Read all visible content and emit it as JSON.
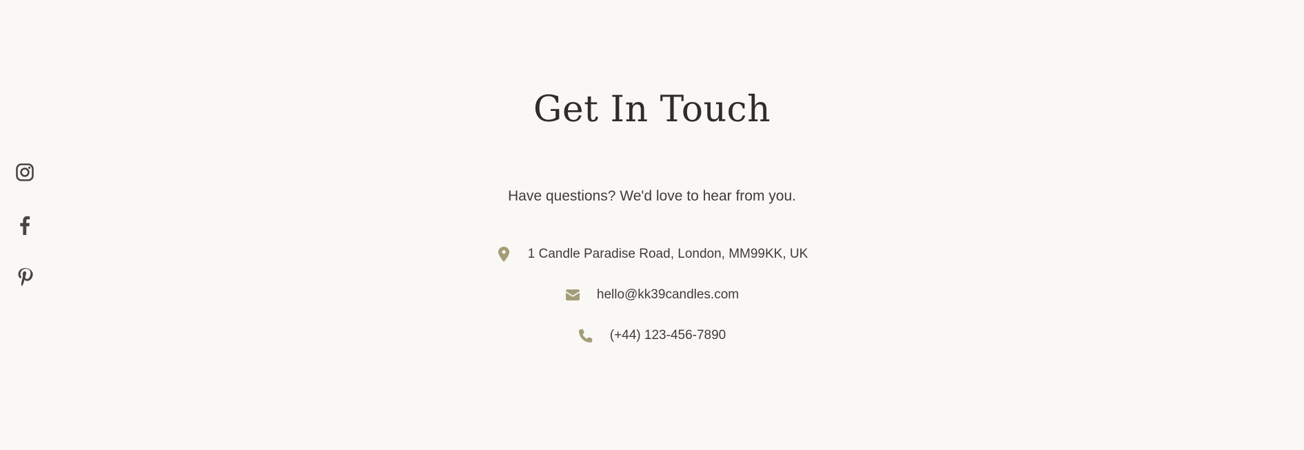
{
  "colors": {
    "background": "#faf8f5",
    "text": "#3f3b38",
    "heading": "#2f2c2a",
    "accent": "#a39d78",
    "social_icon": "#4a4542"
  },
  "social": [
    {
      "icon": "instagram-icon"
    },
    {
      "icon": "facebook-icon"
    },
    {
      "icon": "pinterest-icon"
    }
  ],
  "contact": {
    "title": "Get In Touch",
    "subtitle": "Have questions? We'd love to hear from you.",
    "address": {
      "icon": "map-pin-icon",
      "text": "1 Candle Paradise Road, London, MM99KK, UK"
    },
    "email": {
      "icon": "envelope-icon",
      "text": "hello@kk39candles.com"
    },
    "phone": {
      "icon": "phone-icon",
      "text": "(+44) 123-456-7890"
    }
  }
}
